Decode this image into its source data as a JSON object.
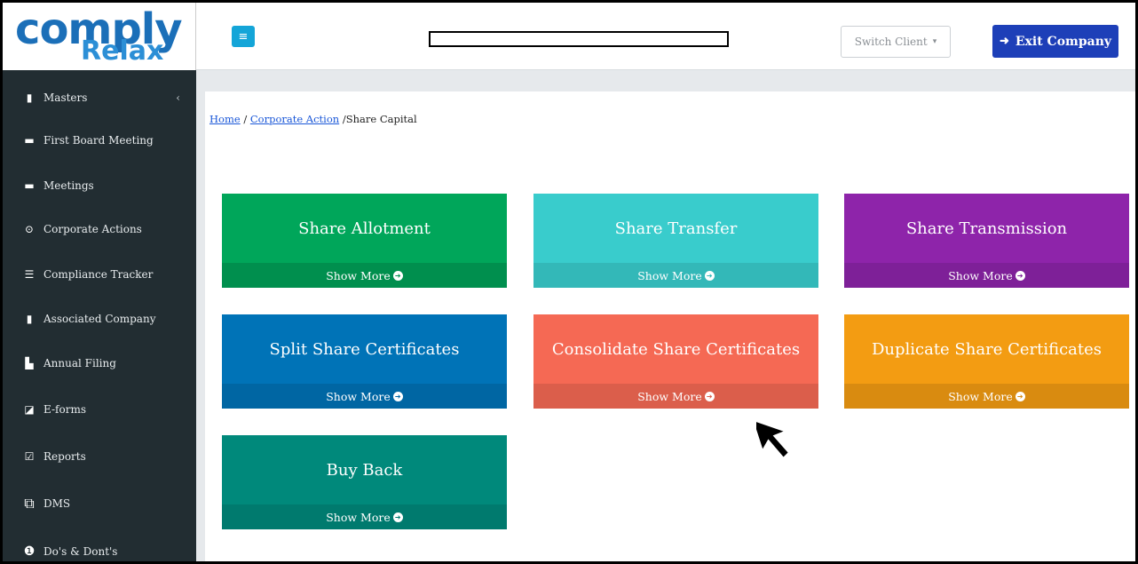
{
  "logo": {
    "word": "comply",
    "sub": "Relax"
  },
  "sidebar": {
    "items": [
      {
        "label": "Masters",
        "icon": "building-icon",
        "has_chevron": true
      },
      {
        "label": "First Board Meeting",
        "icon": "briefcase-icon"
      },
      {
        "label": "Meetings",
        "icon": "briefcase-icon"
      },
      {
        "label": "Corporate Actions",
        "icon": "dot-circle-icon"
      },
      {
        "label": "Compliance Tracker",
        "icon": "list-icon"
      },
      {
        "label": "Associated Company",
        "icon": "building-icon"
      },
      {
        "label": "Annual Filing",
        "icon": "file-icon"
      },
      {
        "label": "E-forms",
        "icon": "external-link-icon"
      },
      {
        "label": "Reports",
        "icon": "check-square-icon"
      },
      {
        "label": "DMS",
        "icon": "copy-icon"
      },
      {
        "label": "Do's & Dont's",
        "icon": "exclamation-circle-icon"
      }
    ],
    "chevron": "‹"
  },
  "topbar": {
    "menu_icon": "≡",
    "switch_client_label": "Switch Client",
    "switch_client_caret": "▾",
    "exit_label": "Exit Company"
  },
  "breadcrumb": {
    "home": "Home",
    "separator1": " / ",
    "corporate_action": "Corporate Action",
    "separator2": " /",
    "current": "Share Capital"
  },
  "tiles": [
    {
      "title": "Share Allotment",
      "more": "Show More",
      "color": "#00a65a",
      "footer_color": "#008f4e"
    },
    {
      "title": "Share Transfer",
      "more": "Show More",
      "color": "#39cccc",
      "footer_color": "#33b8b8"
    },
    {
      "title": "Share Transmission",
      "more": "Show More",
      "color": "#8e24aa",
      "footer_color": "#7e2098"
    },
    {
      "title": "Split Share Certificates",
      "more": "Show More",
      "color": "#0073b7",
      "footer_color": "#0066a3"
    },
    {
      "title": "Consolidate Share Certificates",
      "more": "Show More",
      "color": "#f56954",
      "footer_color": "#db5e4b"
    },
    {
      "title": "Duplicate Share Certificates",
      "more": "Show More",
      "color": "#f39c12",
      "footer_color": "#d98b10"
    },
    {
      "title": "Buy Back",
      "more": "Show More",
      "color": "#00897b",
      "footer_color": "#007a6e"
    }
  ]
}
